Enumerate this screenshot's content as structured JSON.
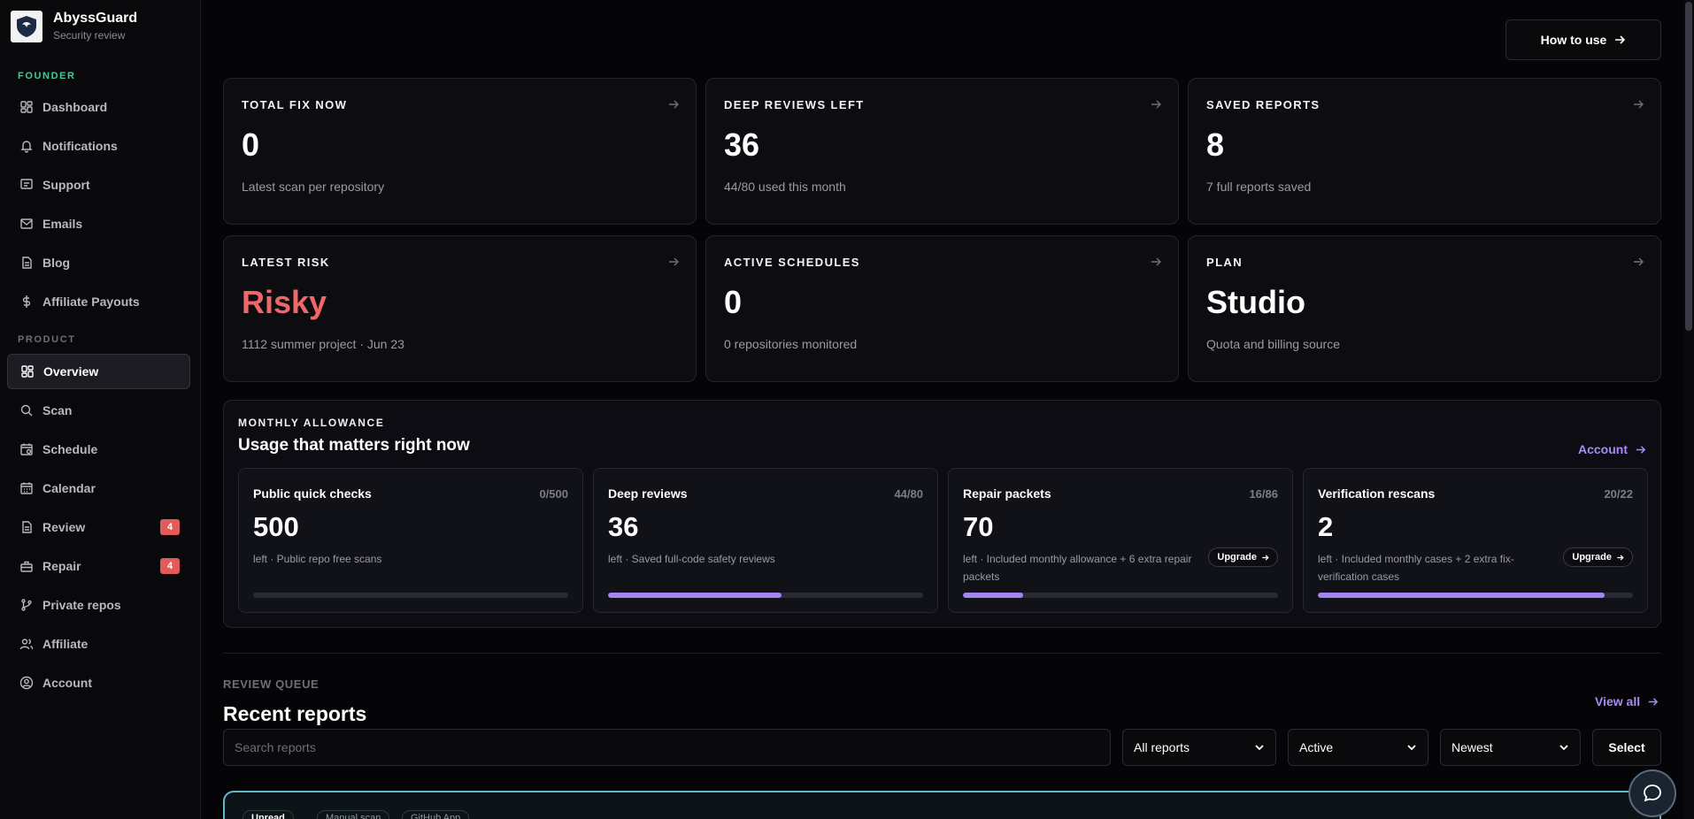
{
  "brand": {
    "name": "AbyssGuard",
    "subtitle": "Security review"
  },
  "sidebar": {
    "founder_label": "FOUNDER",
    "founder_items": [
      {
        "label": "Dashboard",
        "icon": "dashboard-icon"
      },
      {
        "label": "Notifications",
        "icon": "bell-icon"
      },
      {
        "label": "Support",
        "icon": "message-icon"
      },
      {
        "label": "Emails",
        "icon": "mail-icon"
      },
      {
        "label": "Blog",
        "icon": "document-icon"
      },
      {
        "label": "Affiliate Payouts",
        "icon": "dollar-icon"
      }
    ],
    "product_label": "PRODUCT",
    "product_items": [
      {
        "label": "Overview",
        "icon": "dashboard-icon",
        "active": true
      },
      {
        "label": "Scan",
        "icon": "search-icon"
      },
      {
        "label": "Schedule",
        "icon": "calendar-clock-icon"
      },
      {
        "label": "Calendar",
        "icon": "calendar-icon"
      },
      {
        "label": "Review",
        "icon": "document-icon",
        "badge": "4"
      },
      {
        "label": "Repair",
        "icon": "toolbox-icon",
        "badge": "4"
      },
      {
        "label": "Private repos",
        "icon": "git-branch-icon"
      },
      {
        "label": "Affiliate",
        "icon": "users-icon"
      },
      {
        "label": "Account",
        "icon": "user-circle-icon"
      }
    ]
  },
  "header": {
    "how_to_use": "How to use"
  },
  "stats": [
    {
      "title": "TOTAL FIX NOW",
      "value": "0",
      "sub": "Latest scan per repository"
    },
    {
      "title": "DEEP REVIEWS LEFT",
      "value": "36",
      "sub": "44/80 used this month"
    },
    {
      "title": "SAVED REPORTS",
      "value": "8",
      "sub": "7 full reports saved"
    },
    {
      "title": "LATEST RISK",
      "value": "Risky",
      "sub": "1112 summer project · Jun 23",
      "color": "#ee6868"
    },
    {
      "title": "ACTIVE SCHEDULES",
      "value": "0",
      "sub": "0 repositories monitored"
    },
    {
      "title": "PLAN",
      "value": "Studio",
      "sub": "Quota and billing source"
    }
  ],
  "allowance": {
    "label": "MONTHLY ALLOWANCE",
    "title": "Usage that matters right now",
    "account_link": "Account",
    "quotas": [
      {
        "title": "Public quick checks",
        "count": "0/500",
        "value": "500",
        "sub": "left · Public repo free scans",
        "progress": 0
      },
      {
        "title": "Deep reviews",
        "count": "44/80",
        "value": "36",
        "sub": "left · Saved full-code safety reviews",
        "progress": 0.55
      },
      {
        "title": "Repair packets",
        "count": "16/86",
        "value": "70",
        "sub": "left · Included monthly allowance + 6 extra repair packets",
        "progress": 0.19,
        "upgrade": "Upgrade"
      },
      {
        "title": "Verification rescans",
        "count": "20/22",
        "value": "2",
        "sub": "left · Included monthly cases + 2 extra fix-verification cases",
        "progress": 0.91,
        "upgrade": "Upgrade"
      }
    ]
  },
  "review_queue": {
    "label": "REVIEW QUEUE",
    "title": "Recent reports",
    "view_all": "View all",
    "search_placeholder": "Search reports",
    "filter_type": "All reports",
    "filter_status": "Active",
    "sort": "Newest",
    "select_label": "Select",
    "tags": [
      "Unread",
      "Manual scan",
      "GitHub App"
    ]
  },
  "colors": {
    "accent": "#a98bf5",
    "danger": "#ee6868",
    "founder": "#3ecf8e"
  }
}
